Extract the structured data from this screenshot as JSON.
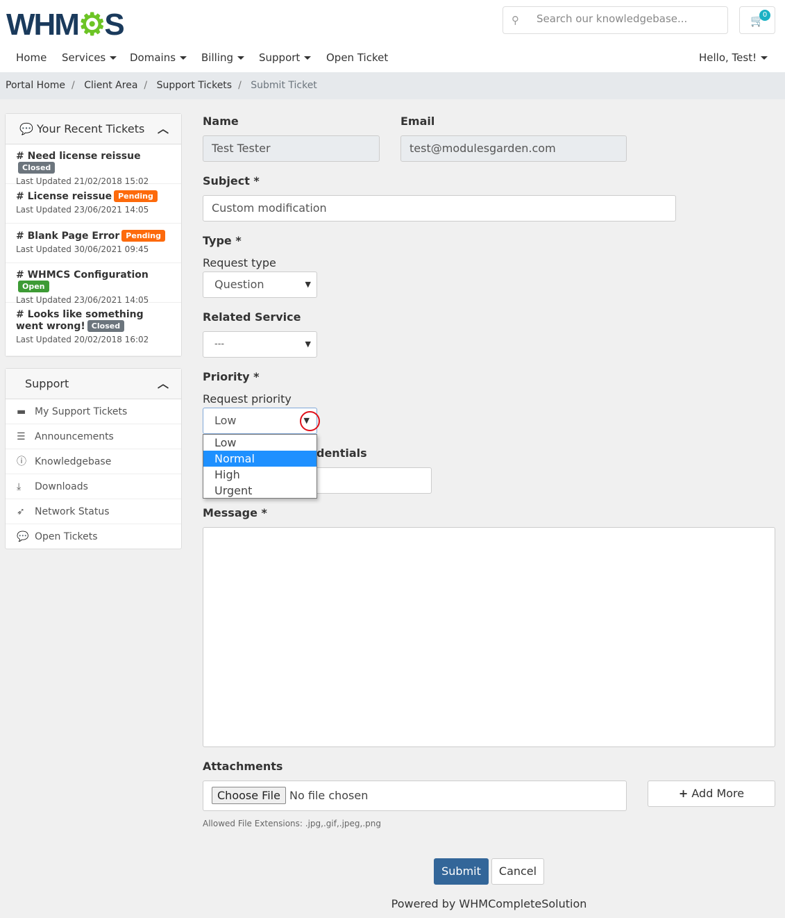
{
  "brand": {
    "logo": "WHMCS",
    "accent": "#6cc425"
  },
  "search": {
    "placeholder": "Search our knowledgebase..."
  },
  "cart": {
    "count": "0"
  },
  "nav": {
    "items": [
      "Home",
      "Services",
      "Domains",
      "Billing",
      "Support",
      "Open Ticket"
    ],
    "user": "Hello, Test!"
  },
  "breadcrumb": [
    "Portal Home",
    "Client Area",
    "Support Tickets",
    "Submit Ticket"
  ],
  "recent": {
    "title": "Your Recent Tickets",
    "tickets": [
      {
        "title": "# Need license reissue",
        "status": "Closed",
        "color": "#6c757d",
        "updated": "Last Updated 21/02/2018 15:02"
      },
      {
        "title": "# License reissue",
        "status": "Pending",
        "color": "#fd6a0c",
        "updated": "Last Updated 23/06/2021 14:05"
      },
      {
        "title": "# Blank Page Error",
        "status": "Pending",
        "color": "#fd6a0c",
        "updated": "Last Updated 30/06/2021 09:45"
      },
      {
        "title": "# WHMCS Configuration",
        "status": "Open",
        "color": "#3d9b35",
        "updated": "Last Updated 23/06/2021 14:05"
      },
      {
        "title": "# Looks like something went wrong!",
        "status": "Closed",
        "color": "#6c757d",
        "updated": "Last Updated 20/02/2018 16:02"
      }
    ]
  },
  "support": {
    "title": "Support",
    "items": [
      {
        "label": "My Support Tickets",
        "icon": "ticket-icon"
      },
      {
        "label": "Announcements",
        "icon": "list-icon"
      },
      {
        "label": "Knowledgebase",
        "icon": "info-icon"
      },
      {
        "label": "Downloads",
        "icon": "download-icon"
      },
      {
        "label": "Network Status",
        "icon": "rocket-icon"
      },
      {
        "label": "Open Tickets",
        "icon": "comments-icon"
      }
    ]
  },
  "form": {
    "name_label": "Name",
    "name_value": "Test Tester",
    "email_label": "Email",
    "email_value": "test@modulesgarden.com",
    "subject_label": "Subject *",
    "subject_value": "Custom modification",
    "type_label": "Type *",
    "request_type_label": "Request type",
    "request_type_value": "Question",
    "related_label": "Related Service",
    "related_value": "---",
    "priority_label": "Priority *",
    "request_priority_label": "Request priority",
    "priority_value": "Low",
    "priority_options": [
      "Low",
      "Normal",
      "High",
      "Urgent"
    ],
    "priority_highlighted": "Normal",
    "hidden_label_fragment": "dentials",
    "message_label": "Message *",
    "attachments_label": "Attachments",
    "choose_file": "Choose File",
    "no_file": "No file chosen",
    "add_more": "Add More",
    "allowed": "Allowed File Extensions: .jpg,.gif,.jpeg,.png",
    "submit": "Submit",
    "cancel": "Cancel"
  },
  "footer": "Powered by WHMCompleteSolution"
}
